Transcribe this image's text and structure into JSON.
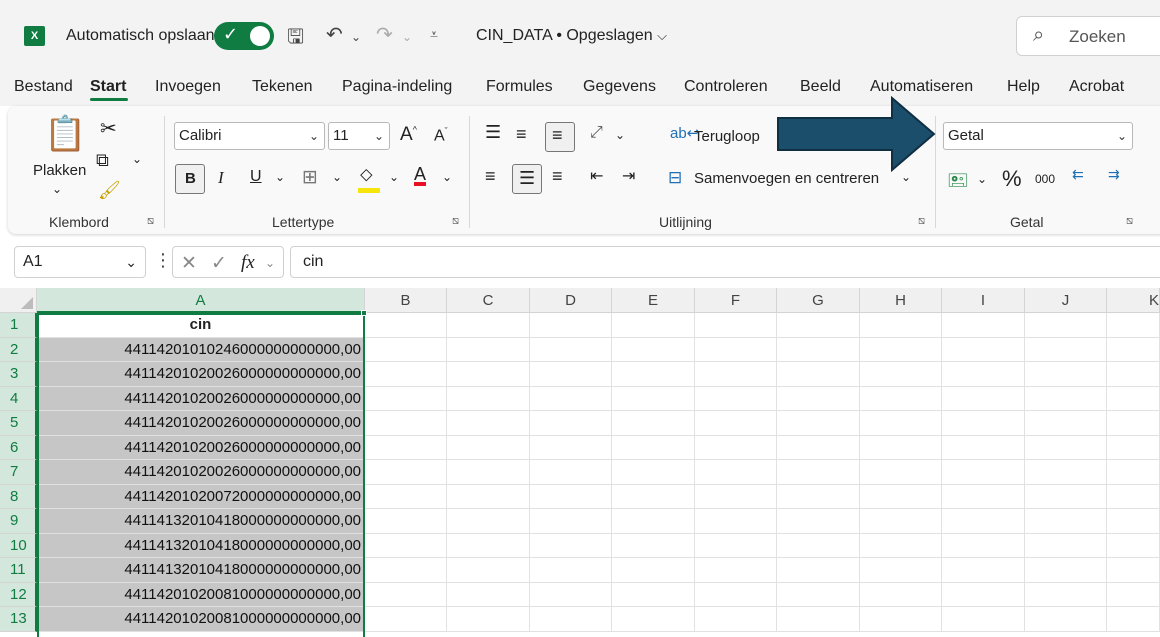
{
  "titlebar": {
    "app_icon": "excel-icon",
    "autosave_label": "Automatisch opslaan",
    "autosave_state": "on",
    "doc_title": "CIN_DATA • Opgeslagen",
    "search_placeholder": "Zoeken"
  },
  "tabs": [
    "Bestand",
    "Start",
    "Invoegen",
    "Tekenen",
    "Pagina-indeling",
    "Formules",
    "Gegevens",
    "Controleren",
    "Beeld",
    "Automatiseren",
    "Help",
    "Acrobat"
  ],
  "active_tab": "Start",
  "ribbon": {
    "clipboard": {
      "paste_label": "Plakken",
      "group_label": "Klembord"
    },
    "font": {
      "font_name": "Calibri",
      "font_size": "11",
      "bold": "B",
      "italic": "I",
      "underline": "U",
      "font_color_letter": "A",
      "group_label": "Lettertype"
    },
    "alignment": {
      "wrap_label": "Terugloop",
      "merge_label": "Samenvoegen en centreren",
      "group_label": "Uitlijning"
    },
    "number": {
      "format": "Getal",
      "percent": "%",
      "thousands": "000",
      "group_label": "Getal"
    }
  },
  "formula_bar": {
    "name_box": "A1",
    "fx": "fx",
    "content": "cin"
  },
  "grid": {
    "columns": [
      "A",
      "B",
      "C",
      "D",
      "E",
      "F",
      "G",
      "H",
      "I",
      "J",
      "K"
    ],
    "rows": [
      {
        "num": "1",
        "a": "cin"
      },
      {
        "num": "2",
        "a": "44114201010246000000000000,00"
      },
      {
        "num": "3",
        "a": "44114201020026000000000000,00"
      },
      {
        "num": "4",
        "a": "44114201020026000000000000,00"
      },
      {
        "num": "5",
        "a": "44114201020026000000000000,00"
      },
      {
        "num": "6",
        "a": "44114201020026000000000000,00"
      },
      {
        "num": "7",
        "a": "44114201020026000000000000,00"
      },
      {
        "num": "8",
        "a": "44114201020072000000000000,00"
      },
      {
        "num": "9",
        "a": "44114132010418000000000000,00"
      },
      {
        "num": "10",
        "a": "44114132010418000000000000,00"
      },
      {
        "num": "11",
        "a": "44114132010418000000000000,00"
      },
      {
        "num": "12",
        "a": "44114201020081000000000000,00"
      },
      {
        "num": "13",
        "a": "44114201020081000000000000,00"
      }
    ]
  },
  "colors": {
    "accent": "#107c41",
    "arrow": "#1b4e6b",
    "selection": "#c6c6c6"
  }
}
